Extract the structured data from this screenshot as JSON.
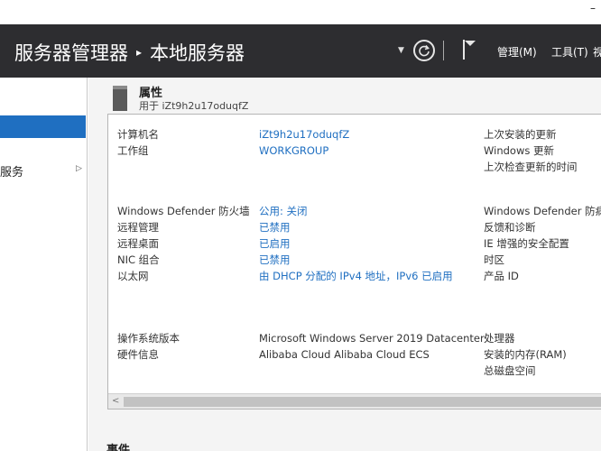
{
  "window": {
    "minimize_glyph": "–"
  },
  "header": {
    "breadcrumb_parent": "服务器管理器",
    "breadcrumb_current": "本地服务器",
    "menu": {
      "manage": "管理(M)",
      "tools": "工具(T)",
      "view_partial": "视"
    }
  },
  "nav": {
    "items": [
      {
        "label": ""
      },
      {
        "label": "服务"
      }
    ]
  },
  "properties": {
    "title": "属性",
    "subtitle": "用于 iZt9h2u17oduqfZ",
    "left_rows": [
      {
        "label": "计算机名",
        "value": "iZt9h2u17oduqfZ"
      },
      {
        "label": "工作组",
        "value": "WORKGROUP"
      },
      {
        "label": "Windows Defender 防火墙",
        "value": "公用: 关闭"
      },
      {
        "label": "远程管理",
        "value": "已禁用"
      },
      {
        "label": "远程桌面",
        "value": "已启用"
      },
      {
        "label": "NIC 组合",
        "value": "已禁用"
      },
      {
        "label": "以太网",
        "value": "由 DHCP 分配的 IPv4 地址，IPv6 已启用"
      },
      {
        "label": "操作系统版本",
        "value": "Microsoft Windows Server 2019 Datacenter"
      },
      {
        "label": "硬件信息",
        "value": "Alibaba Cloud Alibaba Cloud ECS"
      }
    ],
    "right_labels": [
      "上次安装的更新",
      "Windows 更新",
      "上次检查更新的时间",
      "Windows Defender 防病毒",
      "反馈和诊断",
      "IE 增强的安全配置",
      "时区",
      "产品 ID",
      "处理器",
      "安装的内存(RAM)",
      "总磁盘空间"
    ]
  },
  "events": {
    "title": "事件"
  },
  "colors": {
    "header_bg": "#2d2d30",
    "link": "#1f6fc1",
    "nav_selected": "#1f6fc1"
  }
}
